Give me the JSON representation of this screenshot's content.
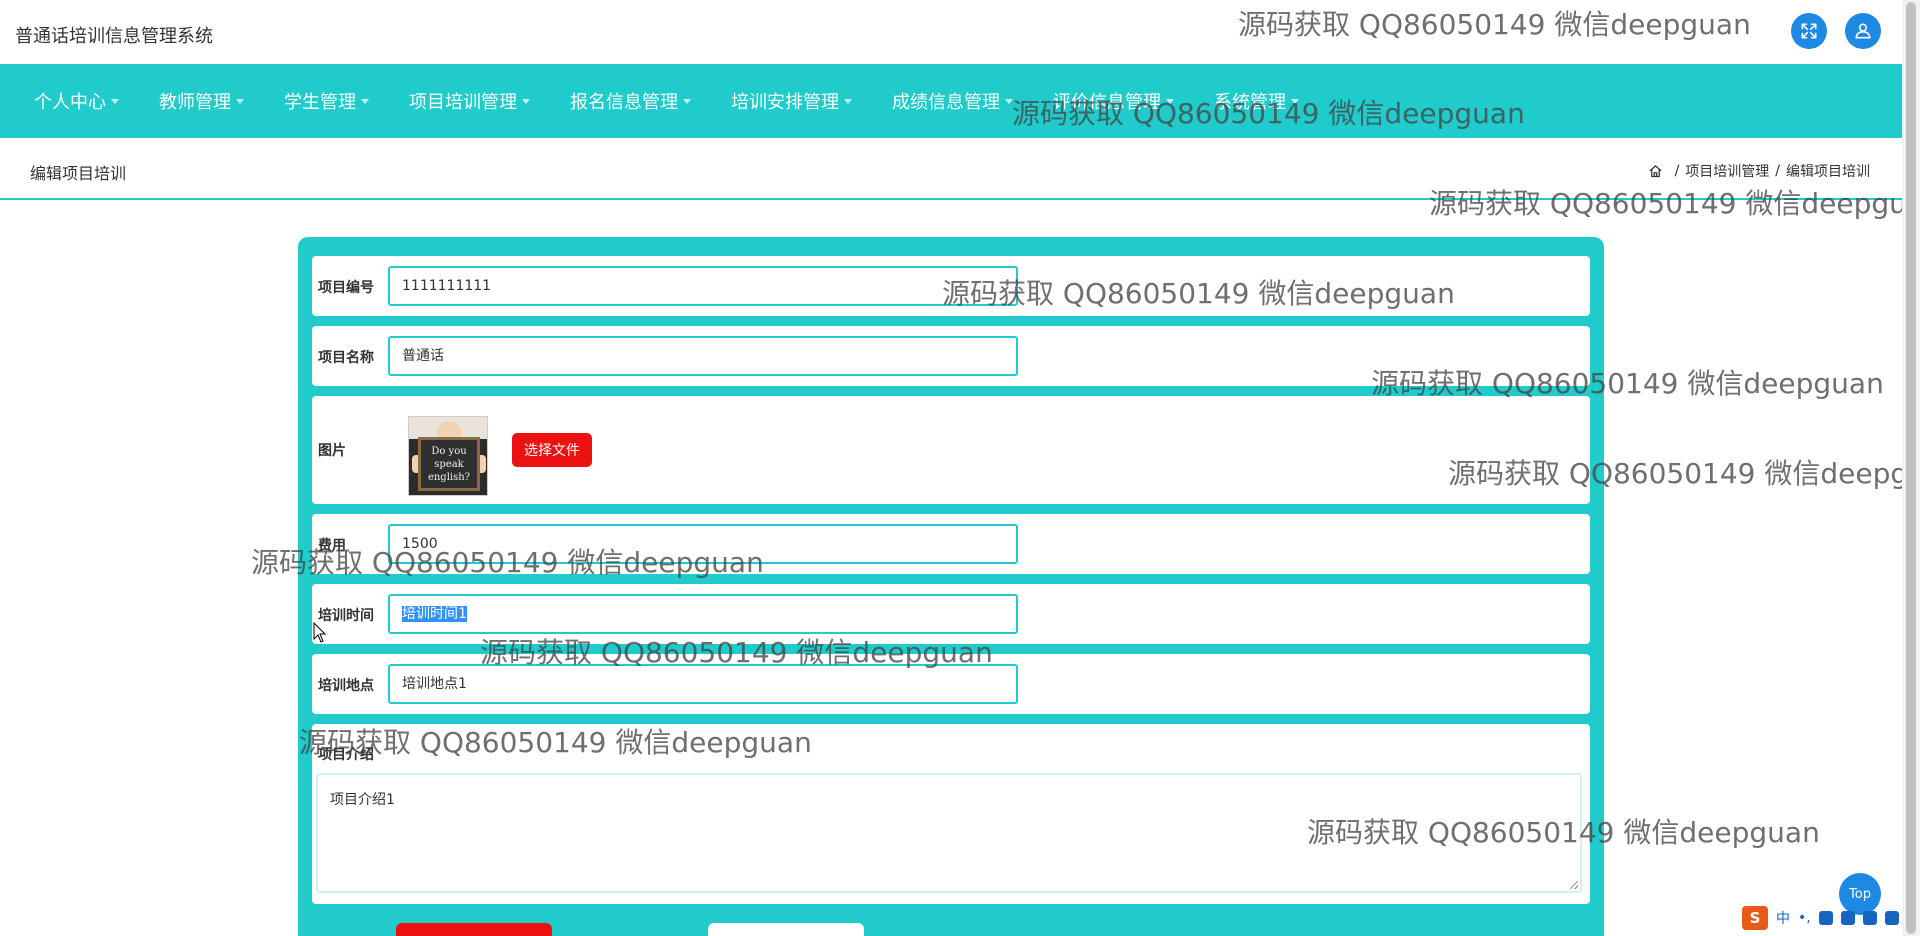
{
  "header": {
    "system_title": "普通话培训信息管理系统"
  },
  "nav": {
    "items": [
      {
        "label": "个人中心"
      },
      {
        "label": "教师管理"
      },
      {
        "label": "学生管理"
      },
      {
        "label": "项目培训管理"
      },
      {
        "label": "报名信息管理"
      },
      {
        "label": "培训安排管理"
      },
      {
        "label": "成绩信息管理"
      },
      {
        "label": "评价信息管理"
      },
      {
        "label": "系统管理"
      }
    ]
  },
  "breadcrumb": {
    "page_heading": "编辑项目培训",
    "separator": "/",
    "items": [
      "项目培训管理",
      "编辑项目培训"
    ]
  },
  "form": {
    "project_no": {
      "label": "项目编号",
      "value": "1111111111"
    },
    "project_name": {
      "label": "项目名称",
      "value": "普通话"
    },
    "image": {
      "label": "图片",
      "button": "选择文件",
      "thumb_text": "Do you speak english?"
    },
    "fee": {
      "label": "费用",
      "value": "1500"
    },
    "train_time": {
      "label": "培训时间",
      "value": "培训时间1"
    },
    "train_place": {
      "label": "培训地点",
      "value": "培训地点1"
    },
    "intro": {
      "label": "项目介绍",
      "value": "项目介绍1"
    }
  },
  "watermark": {
    "text": "源码获取 QQ86050149 微信deepguan"
  },
  "top_button": {
    "label": "Top"
  },
  "ime": {
    "logo": "S",
    "mode": "中",
    "punct": "•,"
  },
  "colors": {
    "accent": "#1fcbcb",
    "primary": "#1e88e5",
    "danger": "#ee1111"
  }
}
